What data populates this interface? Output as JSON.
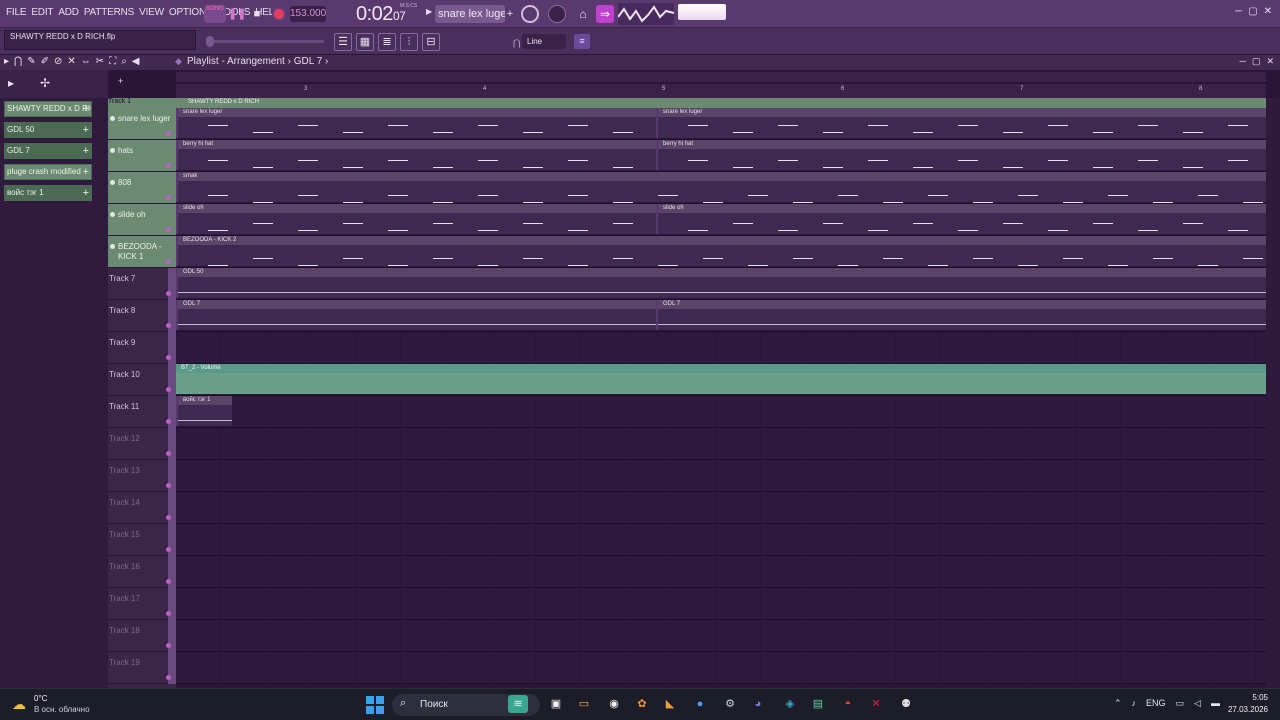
{
  "menu": [
    "FILE",
    "EDIT",
    "ADD",
    "PATTERNS",
    "VIEW",
    "OPTIONS",
    "TOOLS",
    "HELP"
  ],
  "transport": {
    "song_label": "SONG",
    "tempo": "153.000",
    "time_main": "0:02",
    "time_sub": "07",
    "time_unit": "M:S:CS",
    "pattern": "snare lex luger",
    "snap": "Line"
  },
  "hint": "SHAWTY REDD x D RICH.flp",
  "playlist": {
    "title": "Playlist - Arrangement",
    "crumb": "GDL 7",
    "ruler": [
      "3",
      "4",
      "5",
      "6",
      "7",
      "8"
    ]
  },
  "picker": [
    {
      "label": "SHAWTY REDD x D RICH",
      "selected": false
    },
    {
      "label": "GDL 50",
      "selected": true
    },
    {
      "label": "GDL 7",
      "selected": true
    },
    {
      "label": "pluge crash modified",
      "selected": false
    },
    {
      "label": "войс тэг 1",
      "selected": true
    }
  ],
  "track1": {
    "label": "Track 1",
    "clip": "SHAWTY REDD x D RICH"
  },
  "tracks": [
    {
      "name": "snare lex luger",
      "named": true,
      "clips": [
        {
          "label": "snare lex luger",
          "start": 0,
          "end": 480
        },
        {
          "label": "snare lex luger",
          "start": 480,
          "end": 1090
        }
      ]
    },
    {
      "name": "hats",
      "named": true,
      "clips": [
        {
          "label": "berry hi hat",
          "start": 0,
          "end": 480
        },
        {
          "label": "berry hi hat",
          "start": 480,
          "end": 1090
        }
      ]
    },
    {
      "name": "808",
      "named": true,
      "clips": [
        {
          "label": "smak",
          "start": 0,
          "end": 1090
        }
      ]
    },
    {
      "name": "slide oh",
      "named": true,
      "clips": [
        {
          "label": "slide oh",
          "start": 0,
          "end": 480
        },
        {
          "label": "slide oh",
          "start": 480,
          "end": 1090
        }
      ]
    },
    {
      "name": "BEZOODA - KICK 1",
      "named": true,
      "clips": [
        {
          "label": "BEZOODA - KICK 2",
          "start": 0,
          "end": 1090
        }
      ]
    },
    {
      "name": "Track 7",
      "named": false,
      "clips": [
        {
          "label": "GDL 50",
          "start": 0,
          "end": 1090
        }
      ]
    },
    {
      "name": "Track 8",
      "named": false,
      "clips": [
        {
          "label": "GDL 7",
          "start": 0,
          "end": 480
        },
        {
          "label": "GDL 7",
          "start": 480,
          "end": 1090
        }
      ]
    },
    {
      "name": "Track 9",
      "named": false,
      "clips": []
    },
    {
      "name": "Track 10",
      "named": false,
      "clips": [
        {
          "label": "BT_2 - Volume",
          "start": 0,
          "end": 1090,
          "auto": true
        }
      ]
    },
    {
      "name": "Track 11",
      "named": false,
      "clips": [
        {
          "label": "войс тэг 1",
          "start": 0,
          "end": 56
        }
      ]
    },
    {
      "name": "Track 12",
      "named": false,
      "empty": true,
      "clips": []
    },
    {
      "name": "Track 13",
      "named": false,
      "empty": true,
      "clips": []
    },
    {
      "name": "Track 14",
      "named": false,
      "empty": true,
      "clips": []
    },
    {
      "name": "Track 15",
      "named": false,
      "empty": true,
      "clips": []
    },
    {
      "name": "Track 16",
      "named": false,
      "empty": true,
      "clips": []
    },
    {
      "name": "Track 17",
      "named": false,
      "empty": true,
      "clips": []
    },
    {
      "name": "Track 18",
      "named": false,
      "empty": true,
      "clips": []
    },
    {
      "name": "Track 19",
      "named": false,
      "empty": true,
      "clips": []
    }
  ],
  "taskbar": {
    "temp": "0°C",
    "weather": "В осн. облачно",
    "search": "Поиск",
    "lang": "ENG",
    "time": "5:05",
    "date": "27.03.2026"
  },
  "colors": {
    "accent": "#c040d0",
    "track_green": "#6a8a72",
    "automation": "#6aa08a",
    "record": "#e2405a"
  }
}
